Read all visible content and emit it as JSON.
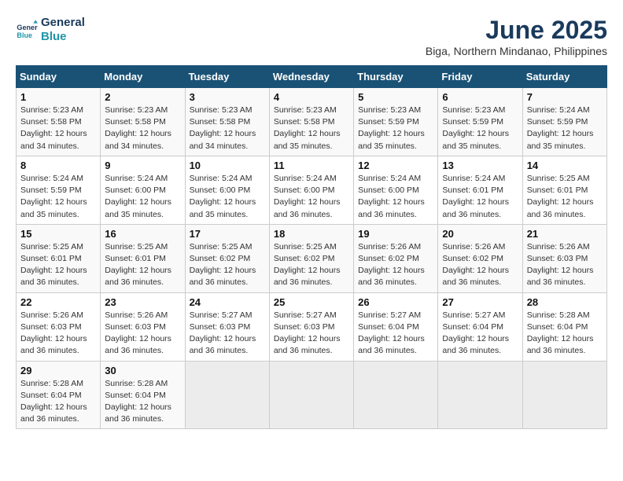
{
  "logo": {
    "line1": "General",
    "line2": "Blue"
  },
  "title": "June 2025",
  "subtitle": "Biga, Northern Mindanao, Philippines",
  "days_of_week": [
    "Sunday",
    "Monday",
    "Tuesday",
    "Wednesday",
    "Thursday",
    "Friday",
    "Saturday"
  ],
  "weeks": [
    [
      {
        "day": "1",
        "sunrise": "5:23 AM",
        "sunset": "5:58 PM",
        "daylight": "12 hours and 34 minutes."
      },
      {
        "day": "2",
        "sunrise": "5:23 AM",
        "sunset": "5:58 PM",
        "daylight": "12 hours and 34 minutes."
      },
      {
        "day": "3",
        "sunrise": "5:23 AM",
        "sunset": "5:58 PM",
        "daylight": "12 hours and 34 minutes."
      },
      {
        "day": "4",
        "sunrise": "5:23 AM",
        "sunset": "5:58 PM",
        "daylight": "12 hours and 35 minutes."
      },
      {
        "day": "5",
        "sunrise": "5:23 AM",
        "sunset": "5:59 PM",
        "daylight": "12 hours and 35 minutes."
      },
      {
        "day": "6",
        "sunrise": "5:23 AM",
        "sunset": "5:59 PM",
        "daylight": "12 hours and 35 minutes."
      },
      {
        "day": "7",
        "sunrise": "5:24 AM",
        "sunset": "5:59 PM",
        "daylight": "12 hours and 35 minutes."
      }
    ],
    [
      {
        "day": "8",
        "sunrise": "5:24 AM",
        "sunset": "5:59 PM",
        "daylight": "12 hours and 35 minutes."
      },
      {
        "day": "9",
        "sunrise": "5:24 AM",
        "sunset": "6:00 PM",
        "daylight": "12 hours and 35 minutes."
      },
      {
        "day": "10",
        "sunrise": "5:24 AM",
        "sunset": "6:00 PM",
        "daylight": "12 hours and 35 minutes."
      },
      {
        "day": "11",
        "sunrise": "5:24 AM",
        "sunset": "6:00 PM",
        "daylight": "12 hours and 36 minutes."
      },
      {
        "day": "12",
        "sunrise": "5:24 AM",
        "sunset": "6:00 PM",
        "daylight": "12 hours and 36 minutes."
      },
      {
        "day": "13",
        "sunrise": "5:24 AM",
        "sunset": "6:01 PM",
        "daylight": "12 hours and 36 minutes."
      },
      {
        "day": "14",
        "sunrise": "5:25 AM",
        "sunset": "6:01 PM",
        "daylight": "12 hours and 36 minutes."
      }
    ],
    [
      {
        "day": "15",
        "sunrise": "5:25 AM",
        "sunset": "6:01 PM",
        "daylight": "12 hours and 36 minutes."
      },
      {
        "day": "16",
        "sunrise": "5:25 AM",
        "sunset": "6:01 PM",
        "daylight": "12 hours and 36 minutes."
      },
      {
        "day": "17",
        "sunrise": "5:25 AM",
        "sunset": "6:02 PM",
        "daylight": "12 hours and 36 minutes."
      },
      {
        "day": "18",
        "sunrise": "5:25 AM",
        "sunset": "6:02 PM",
        "daylight": "12 hours and 36 minutes."
      },
      {
        "day": "19",
        "sunrise": "5:26 AM",
        "sunset": "6:02 PM",
        "daylight": "12 hours and 36 minutes."
      },
      {
        "day": "20",
        "sunrise": "5:26 AM",
        "sunset": "6:02 PM",
        "daylight": "12 hours and 36 minutes."
      },
      {
        "day": "21",
        "sunrise": "5:26 AM",
        "sunset": "6:03 PM",
        "daylight": "12 hours and 36 minutes."
      }
    ],
    [
      {
        "day": "22",
        "sunrise": "5:26 AM",
        "sunset": "6:03 PM",
        "daylight": "12 hours and 36 minutes."
      },
      {
        "day": "23",
        "sunrise": "5:26 AM",
        "sunset": "6:03 PM",
        "daylight": "12 hours and 36 minutes."
      },
      {
        "day": "24",
        "sunrise": "5:27 AM",
        "sunset": "6:03 PM",
        "daylight": "12 hours and 36 minutes."
      },
      {
        "day": "25",
        "sunrise": "5:27 AM",
        "sunset": "6:03 PM",
        "daylight": "12 hours and 36 minutes."
      },
      {
        "day": "26",
        "sunrise": "5:27 AM",
        "sunset": "6:04 PM",
        "daylight": "12 hours and 36 minutes."
      },
      {
        "day": "27",
        "sunrise": "5:27 AM",
        "sunset": "6:04 PM",
        "daylight": "12 hours and 36 minutes."
      },
      {
        "day": "28",
        "sunrise": "5:28 AM",
        "sunset": "6:04 PM",
        "daylight": "12 hours and 36 minutes."
      }
    ],
    [
      {
        "day": "29",
        "sunrise": "5:28 AM",
        "sunset": "6:04 PM",
        "daylight": "12 hours and 36 minutes."
      },
      {
        "day": "30",
        "sunrise": "5:28 AM",
        "sunset": "6:04 PM",
        "daylight": "12 hours and 36 minutes."
      },
      null,
      null,
      null,
      null,
      null
    ]
  ]
}
